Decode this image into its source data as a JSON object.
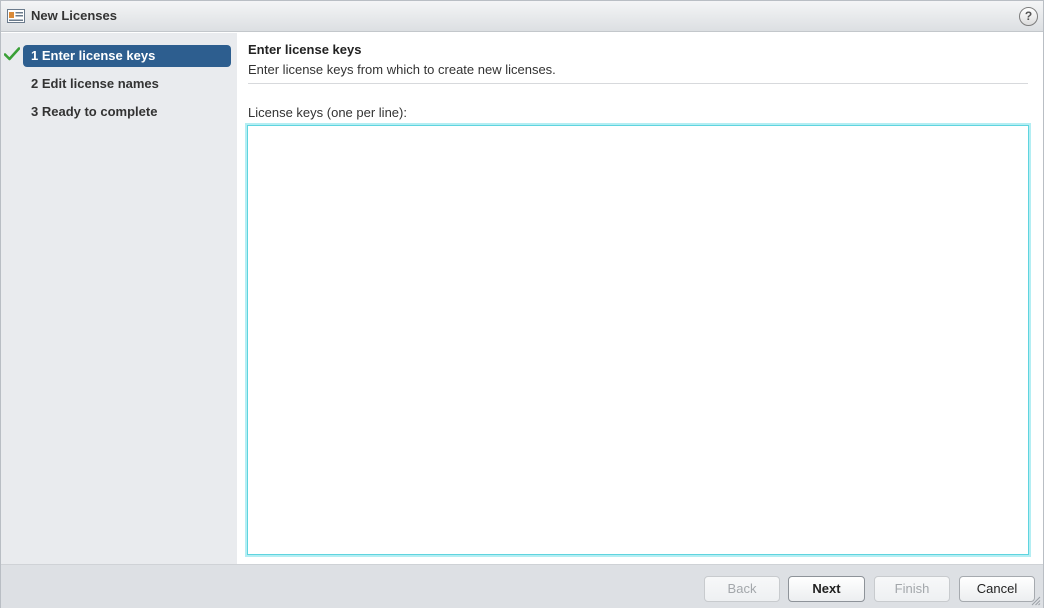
{
  "window": {
    "title": "New Licenses",
    "help_icon": "?"
  },
  "steps": [
    {
      "label": "1  Enter license keys",
      "state": "active",
      "completed": true
    },
    {
      "label": "2  Edit license names",
      "state": "pending"
    },
    {
      "label": "3  Ready to complete",
      "state": "pending"
    }
  ],
  "page": {
    "title": "Enter license keys",
    "description": "Enter license keys from which to create new licenses.",
    "field_label": "License keys (one per line):",
    "field_value": ""
  },
  "footer": {
    "back": "Back",
    "next": "Next",
    "finish": "Finish",
    "cancel": "Cancel"
  },
  "colors": {
    "accent": "#2d5e8f",
    "check": "#3aa037",
    "focus": "#5fd4df"
  }
}
